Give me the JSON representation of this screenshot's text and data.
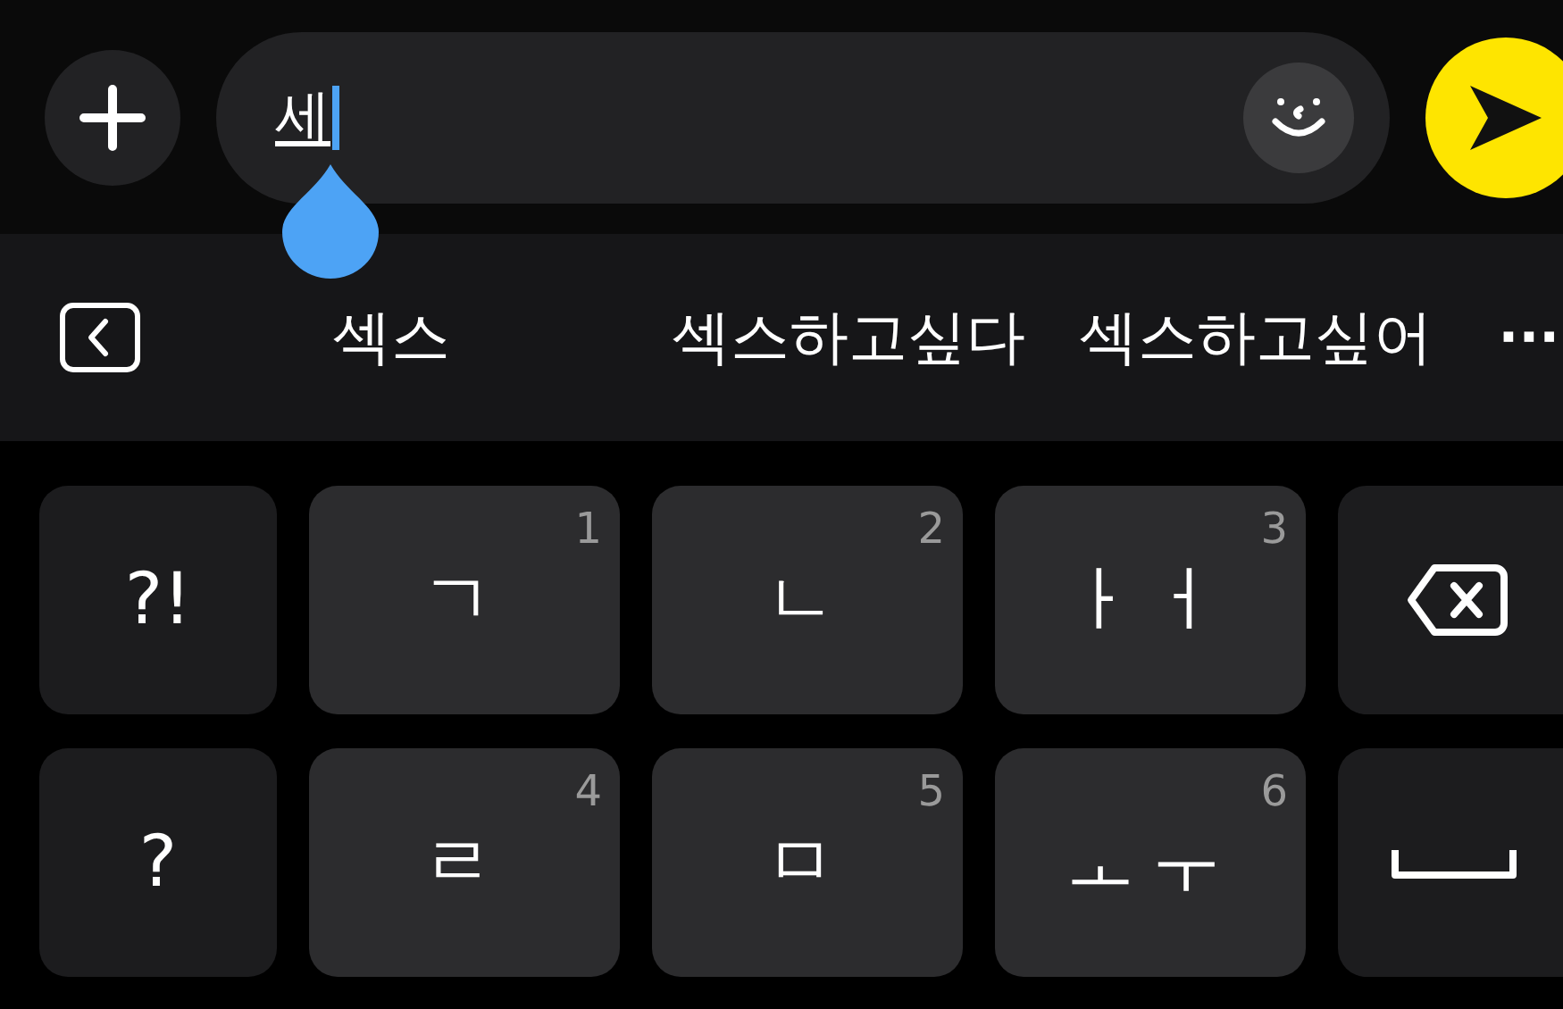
{
  "composer": {
    "value": "세"
  },
  "suggestions": [
    "섹스",
    "섹스하고싶다",
    "섹스하고싶어"
  ],
  "more": "···",
  "keys": [
    {
      "kind": "symbol",
      "label": "?!"
    },
    {
      "kind": "char",
      "label": "ㄱ",
      "number": "1"
    },
    {
      "kind": "char",
      "label": "ㄴ",
      "number": "2"
    },
    {
      "kind": "char",
      "label": "ㅏㅓ",
      "number": "3"
    },
    {
      "kind": "backspace"
    },
    {
      "kind": "symbol",
      "label": "?"
    },
    {
      "kind": "char",
      "label": "ㄹ",
      "number": "4"
    },
    {
      "kind": "char",
      "label": "ㅁ",
      "number": "5"
    },
    {
      "kind": "char",
      "label": "ㅗㅜ",
      "number": "6"
    },
    {
      "kind": "space"
    }
  ]
}
